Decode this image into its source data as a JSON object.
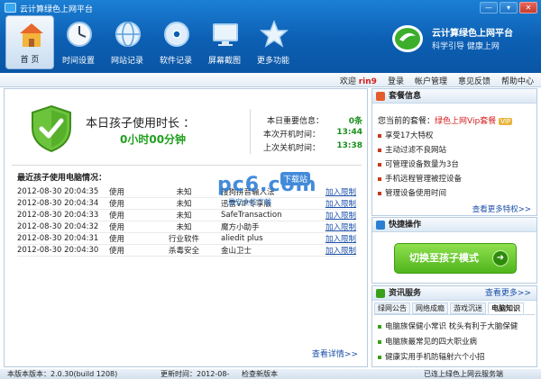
{
  "window": {
    "title": "云计算绿色上网平台",
    "controls": [
      "—",
      "▾",
      "✕"
    ]
  },
  "nav": [
    {
      "label": "首 页",
      "icon": "home-icon",
      "active": true
    },
    {
      "label": "时间设置",
      "icon": "clock-icon"
    },
    {
      "label": "网站记录",
      "icon": "globe-icon"
    },
    {
      "label": "软件记录",
      "icon": "disc-icon"
    },
    {
      "label": "屏幕截图",
      "icon": "monitor-icon"
    },
    {
      "label": "更多功能",
      "icon": "star-icon"
    }
  ],
  "brand": {
    "name": "云计算绿色上网平台",
    "slogan": "科学引导  健康上网"
  },
  "menubar": {
    "welcome": "欢迎",
    "username": "rin9",
    "login": "登录",
    "links": [
      "帐户管理",
      "意见反馈",
      "帮助中心"
    ]
  },
  "usage": {
    "title": "本日孩子使用时长 ：",
    "value": "0小时00分钟",
    "info": [
      {
        "label": "本日重要信息：",
        "value": "0条"
      },
      {
        "label": "本次开机时间：",
        "value": "13:44"
      },
      {
        "label": "上次关机时间：",
        "value": "13:38"
      }
    ]
  },
  "recent": {
    "title": "最近孩子使用电脑情况：",
    "rows": [
      {
        "time": "2012-08-30 20:04:35",
        "action": "使用",
        "category": "未知",
        "name": "搜狗拼音输入法",
        "link": "加入限制"
      },
      {
        "time": "2012-08-30 20:04:34",
        "action": "使用",
        "category": "未知",
        "name": "迅雷VIP专享版",
        "link": "加入限制"
      },
      {
        "time": "2012-08-30 20:04:33",
        "action": "使用",
        "category": "未知",
        "name": "SafeTransaction",
        "link": "加入限制"
      },
      {
        "time": "2012-08-30 20:04:32",
        "action": "使用",
        "category": "未知",
        "name": "魔方小助手",
        "link": "加入限制"
      },
      {
        "time": "2012-08-30 20:04:31",
        "action": "使用",
        "category": "行业软件",
        "name": "aliedit plus",
        "link": "加入限制"
      },
      {
        "time": "2012-08-30 20:04:30",
        "action": "使用",
        "category": "杀毒安全",
        "name": "金山卫士",
        "link": "加入限制"
      }
    ],
    "more": "查看详情>>"
  },
  "watermark": {
    "text": "pc6",
    "badge": "下载站",
    "domain": ".com",
    "sub": "最安全的下载"
  },
  "package": {
    "title": "套餐信息",
    "current_label": "您当前的套餐：",
    "current_name": "绿色上网Vip套餐",
    "vip": "VIP",
    "features": [
      "享受17大特权",
      "主动过滤不良网站",
      "可管理设备数量为3台",
      "手机远程管理被控设备",
      "管理设备使用时间"
    ],
    "more": "查看更多特权>>"
  },
  "quick": {
    "title": "快捷操作",
    "button": "切换至孩子模式",
    "arrow": "➜"
  },
  "news": {
    "title": "资讯服务",
    "more": "查看更多>>",
    "tabs": [
      "绿网公告",
      "网络成瘾",
      "游戏沉迷",
      "电脑知识"
    ],
    "active_tab": 3,
    "items": [
      "电脑族保健小常识  枕头有利于大脑保健",
      "电脑族最常见的四大职业病",
      "健康实用手机防辐射六个小招"
    ]
  },
  "status": {
    "version": "本版本版本：2.0.30(build 1208)",
    "update": "更新时间：2012-08-",
    "check": "检查新版本",
    "right": "已连上绿色上网云服务端"
  }
}
